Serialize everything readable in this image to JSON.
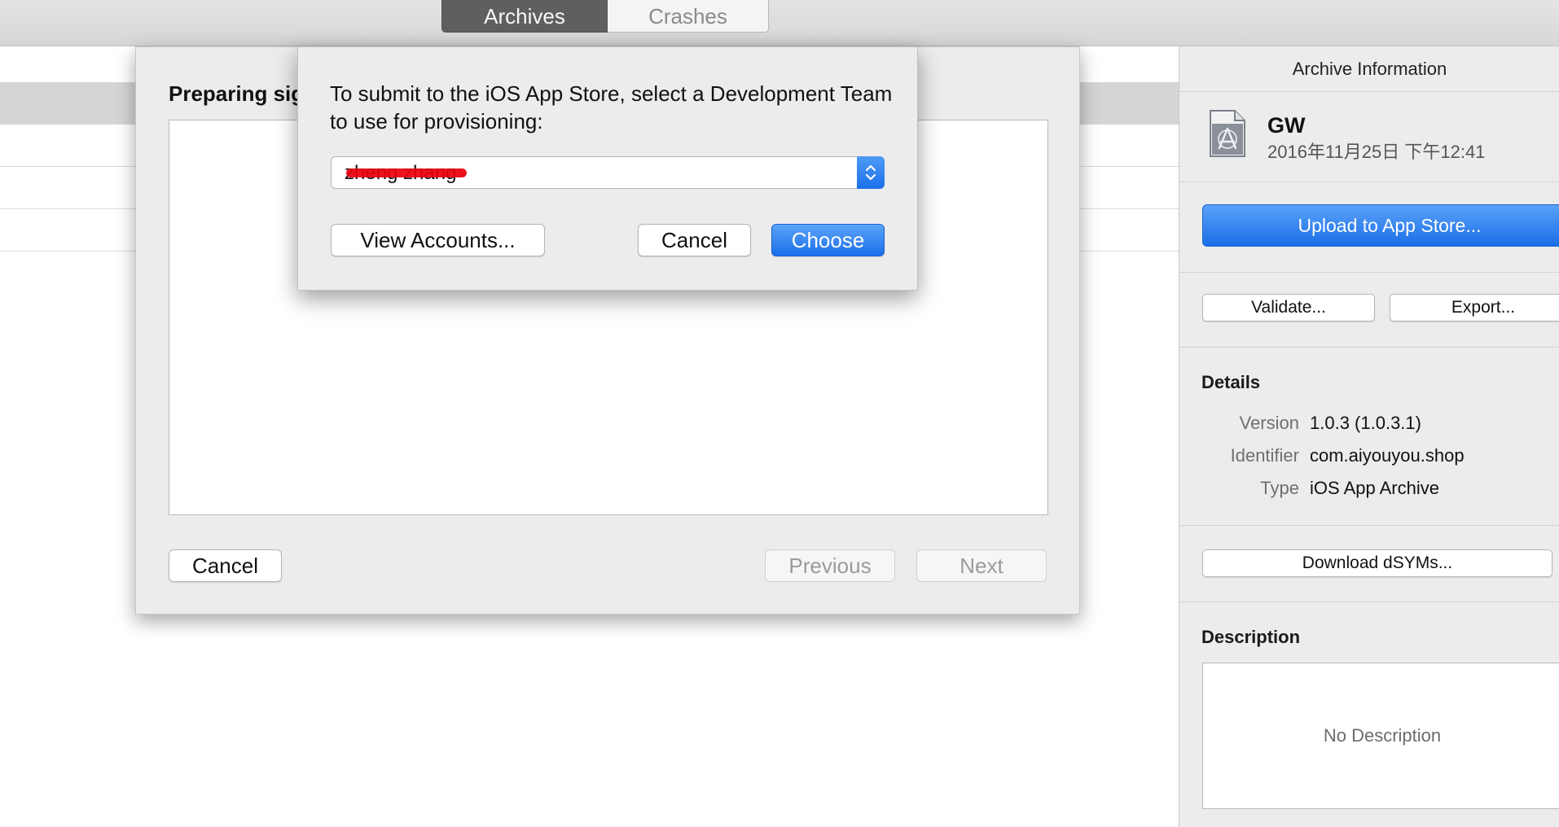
{
  "toolbar": {
    "tabs": [
      {
        "label": "Archives",
        "selected": true
      },
      {
        "label": "Crashes",
        "selected": false
      }
    ]
  },
  "sheet": {
    "title": "Preparing sig",
    "cancel_label": "Cancel",
    "previous_label": "Previous",
    "next_label": "Next"
  },
  "dialog": {
    "message": "To submit to the iOS App Store, select a Development Team to use for provisioning:",
    "team_value": "zheng zhang",
    "view_accounts_label": "View Accounts...",
    "cancel_label": "Cancel",
    "choose_label": "Choose"
  },
  "inspector": {
    "header": "Archive Information",
    "app_name": "GW",
    "date": "2016年11月25日 下午12:41",
    "upload_label": "Upload to App Store...",
    "validate_label": "Validate...",
    "export_label": "Export...",
    "details_title": "Details",
    "details": [
      {
        "label": "Version",
        "value": "1.0.3 (1.0.3.1)"
      },
      {
        "label": "Identifier",
        "value": "com.aiyouyou.shop"
      },
      {
        "label": "Type",
        "value": "iOS App Archive"
      }
    ],
    "download_dsyms_label": "Download dSYMs...",
    "description_title": "Description",
    "description_placeholder": "No Description"
  },
  "colors": {
    "accent": "#1b6fe9",
    "selected_tab": "#5f5f5f",
    "redaction": "#e8000c"
  },
  "icons": {
    "archive": "app-archive-icon",
    "select": "chevron-updown-icon"
  }
}
